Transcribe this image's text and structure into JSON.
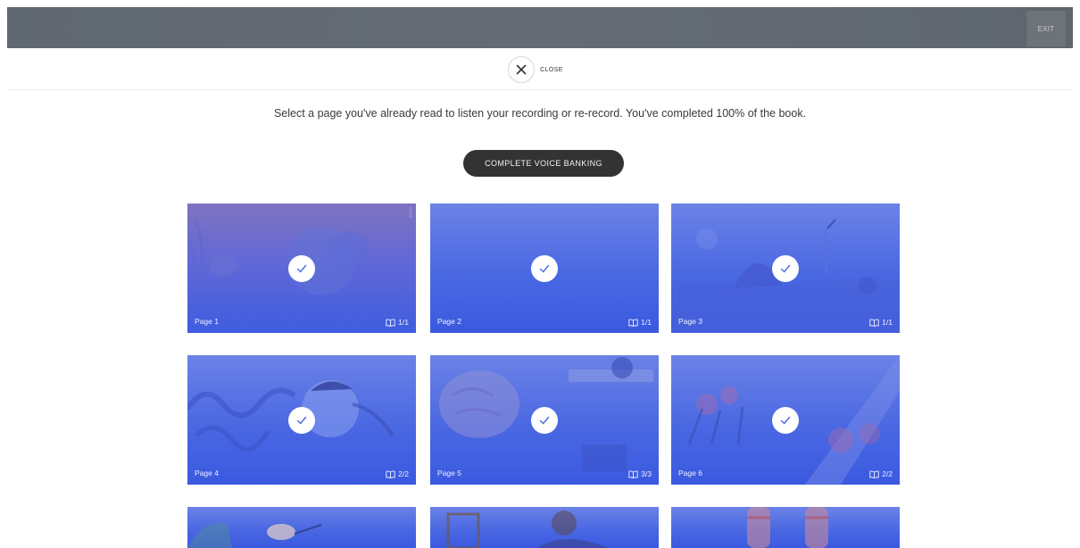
{
  "header": {
    "exit_label": "EXIT"
  },
  "close": {
    "label": "CLOSE"
  },
  "instructions": "Select a page you've already read to listen your recording or re-record. You've completed 100% of the book.",
  "complete_button": "COMPLETE VOICE BANKING",
  "pages": [
    {
      "label": "Page 1",
      "count": "1/1",
      "completed": true
    },
    {
      "label": "Page 2",
      "count": "1/1",
      "completed": true
    },
    {
      "label": "Page 3",
      "count": "1/1",
      "completed": true
    },
    {
      "label": "Page 4",
      "count": "2/2",
      "completed": true
    },
    {
      "label": "Page 5",
      "count": "3/3",
      "completed": true
    },
    {
      "label": "Page 6",
      "count": "2/2",
      "completed": true
    }
  ],
  "colors": {
    "tile_blue": "#4a68e2",
    "button_dark": "#333333",
    "topbar": "#62696f"
  },
  "icons": {
    "check": "checkmark-icon",
    "close": "close-icon",
    "book": "book-icon"
  }
}
